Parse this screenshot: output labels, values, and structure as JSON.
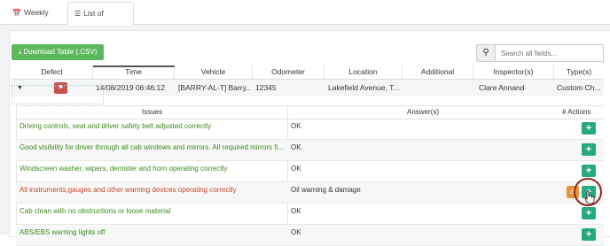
{
  "tabs": [
    {
      "label": "Weekly View",
      "icon": "calendar-icon"
    },
    {
      "label": "List of checks",
      "icon": "list-icon"
    }
  ],
  "toolbar": {
    "download_label": "Download Table (.CSV)",
    "search_placeholder": "Search all fields..."
  },
  "table": {
    "columns": [
      "Defect",
      "Time",
      "Vehicle",
      "Odometer",
      "Location",
      "Additional Comments",
      "Inspector(s)",
      "Type(s)"
    ],
    "row": {
      "time": "14/08/2019 06:46:12",
      "vehicle": "[BARRY-AL-T] Barry...",
      "odometer": "12345",
      "location": "Lakefield Avenue, T...",
      "additional_comments": "",
      "inspector": "Clare Annand",
      "type": "Custom Ch..."
    }
  },
  "subtable": {
    "columns": [
      "Issues",
      "Answer(s)",
      "# Actions"
    ],
    "rows": [
      {
        "issue": "Driving controls, seat and driver safety belt adjusted correctly",
        "answer": "OK",
        "status": "ok"
      },
      {
        "issue": "Good visibility for driver through all cab windows and mirrors. All required mirrors fitte...",
        "answer": "OK",
        "status": "ok"
      },
      {
        "issue": "Windscreen washer, wipers, demister and horn operating correctly",
        "answer": "OK",
        "status": "ok"
      },
      {
        "issue": "All instruments,gauges and other warning devices operating correctly",
        "answer": "Oil warning & damage",
        "status": "defect"
      },
      {
        "issue": "Cab clean with no obstructions or loose material",
        "answer": "OK",
        "status": "ok"
      },
      {
        "issue": "ABS/EBS warning lights off",
        "answer": "OK",
        "status": "ok"
      }
    ]
  },
  "colors": {
    "ok_text": "#3c8a1e",
    "defect_text": "#c14a2b",
    "action_button": "#26a980",
    "download_button": "#5cb85c",
    "defect_badge": "#c9524f",
    "warning_badge": "#e8943a"
  }
}
